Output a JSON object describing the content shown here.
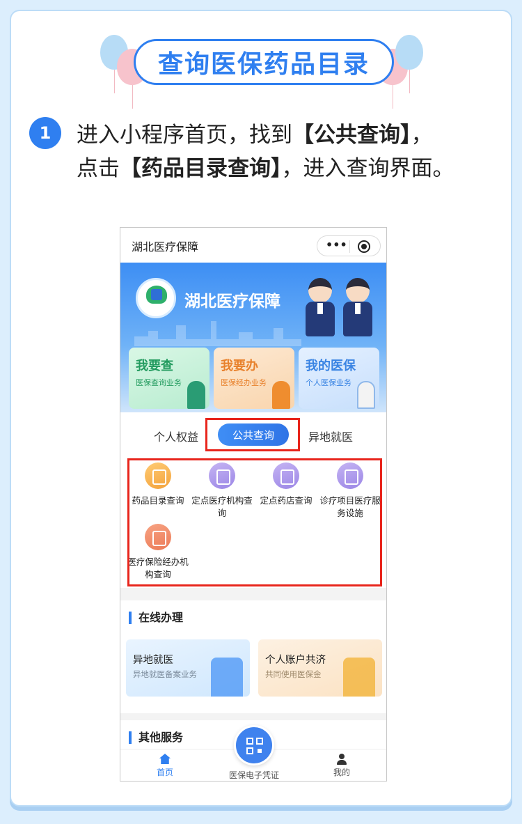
{
  "guide": {
    "title": "查询医保药品目录",
    "step_number": "1",
    "step_line1_pre": "进入小程序首页，找到",
    "step_line1_bold": "【公共查询】",
    "step_line1_post": "，",
    "step_line2_pre": "点击",
    "step_line2_bold": "【药品目录查询】",
    "step_line2_post": "，进入查询界面。"
  },
  "phone": {
    "app_title": "湖北医疗保障",
    "capsule_more": "•••",
    "hero_title": "湖北医疗保障",
    "tiles": [
      {
        "title": "我要查",
        "subtitle": "医保查询业务"
      },
      {
        "title": "我要办",
        "subtitle": "医保经办业务"
      },
      {
        "title": "我的医保",
        "subtitle": "个人医保业务"
      }
    ],
    "tabs": {
      "left": "个人权益",
      "active": "公共查询",
      "right": "异地就医"
    },
    "grid": [
      {
        "label": "药品目录查询"
      },
      {
        "label": "定点医疗机构查询"
      },
      {
        "label": "定点药店查询"
      },
      {
        "label": "诊疗项目医疗服务设施"
      },
      {
        "label": "医疗保险经办机构查询"
      }
    ],
    "online": {
      "section_title": "在线办理",
      "cards": [
        {
          "title": "异地就医",
          "subtitle": "异地就医备案业务"
        },
        {
          "title": "个人账户共济",
          "subtitle": "共同使用医保金"
        }
      ]
    },
    "other": {
      "section_title": "其他服务"
    },
    "nav": {
      "home": "首页",
      "cert": "医保电子凭证",
      "mine": "我的"
    }
  },
  "colors": {
    "accent": "#2f7ff0",
    "highlight_red": "#e8251c",
    "page_bg": "#dceefd"
  }
}
